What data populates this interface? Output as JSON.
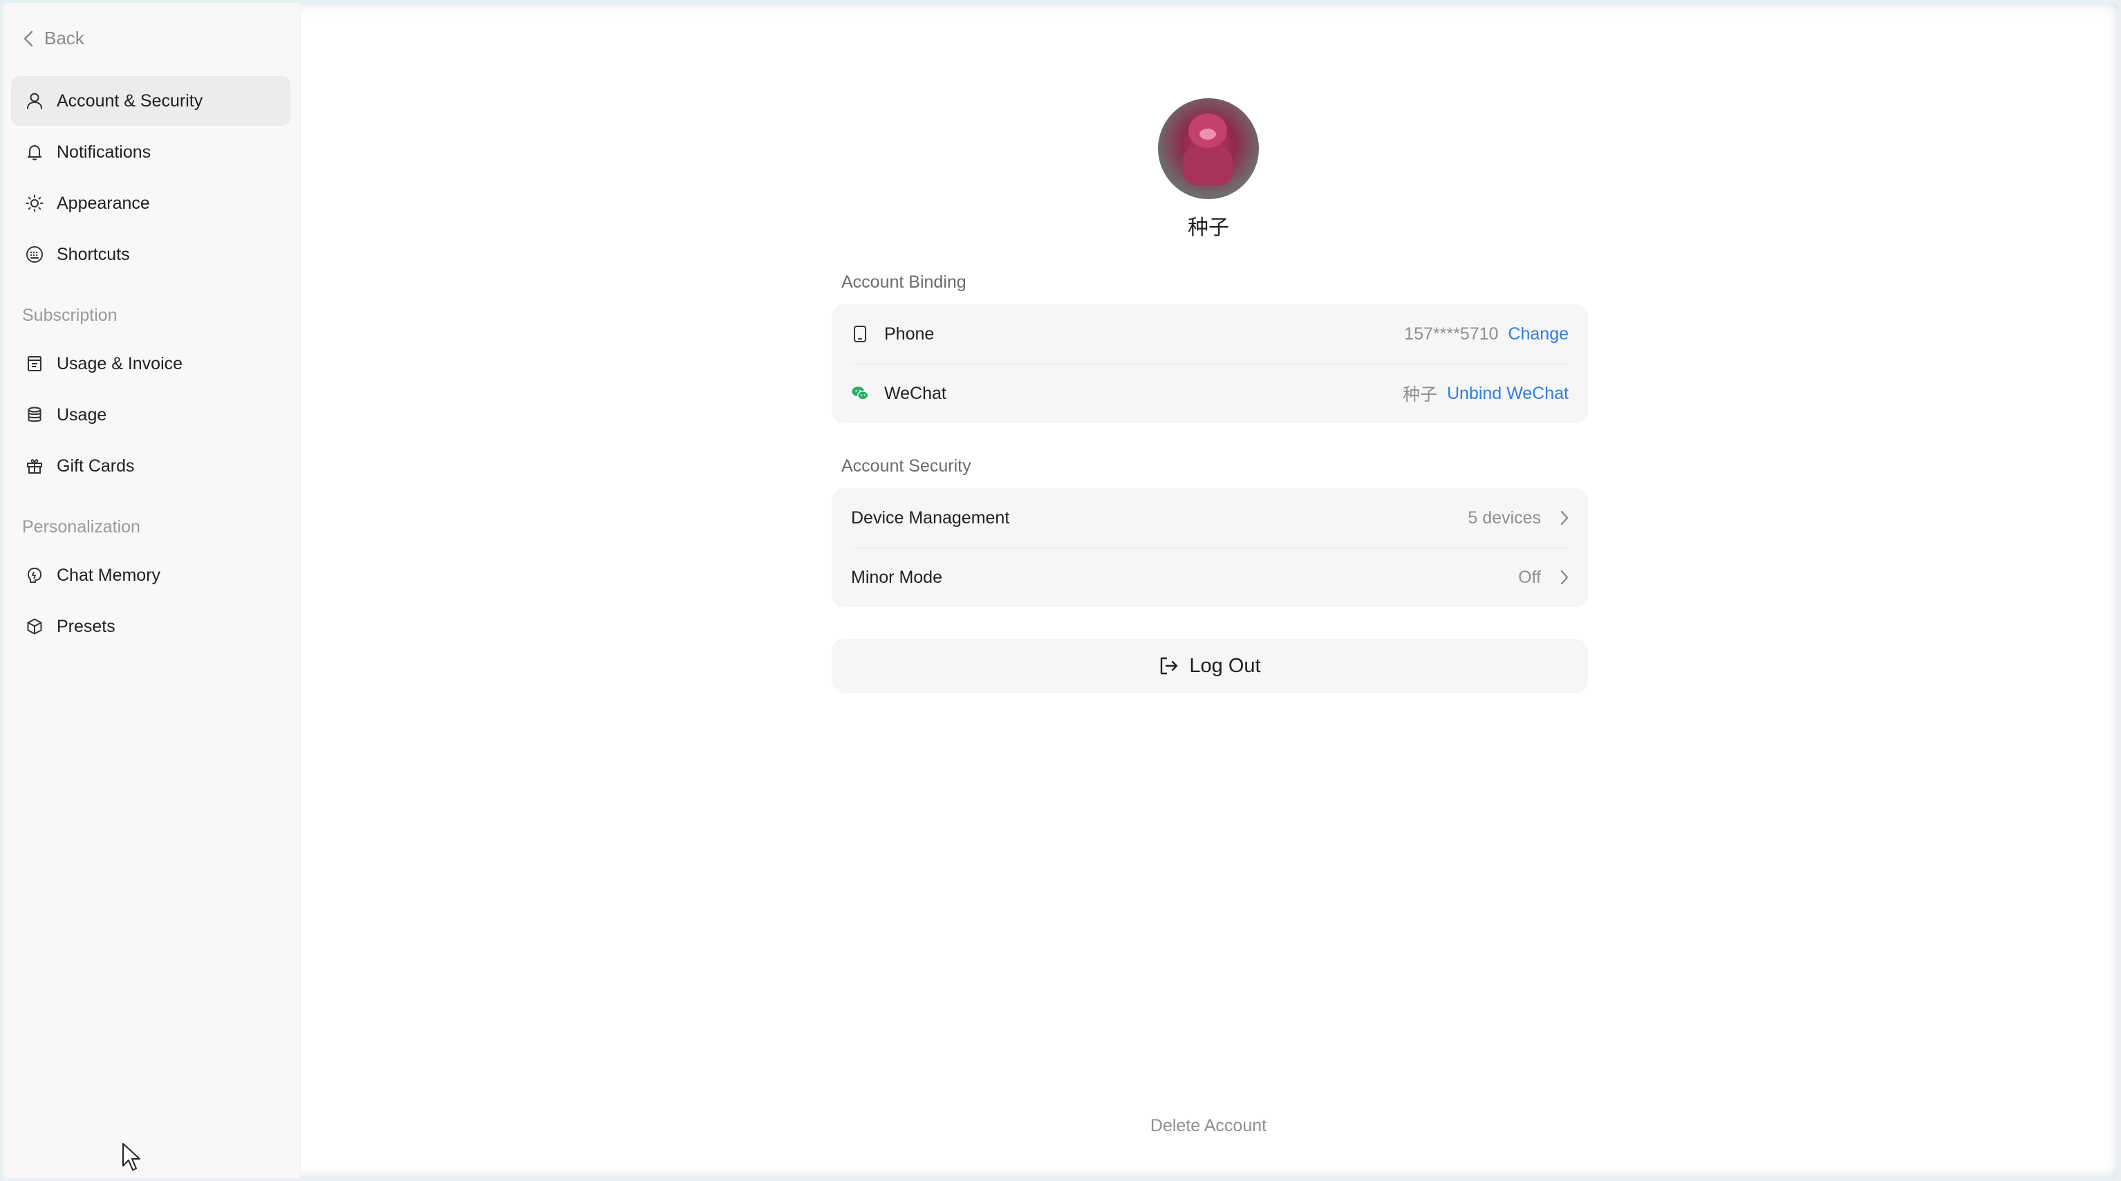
{
  "sidebar": {
    "back_label": "Back",
    "items_top": [
      {
        "label": "Account & Security",
        "icon": "user-icon",
        "active": true
      },
      {
        "label": "Notifications",
        "icon": "bell-icon"
      },
      {
        "label": "Appearance",
        "icon": "sun-icon"
      },
      {
        "label": "Shortcuts",
        "icon": "keyboard-icon"
      }
    ],
    "section_subscription": "Subscription",
    "items_subscription": [
      {
        "label": "Usage & Invoice",
        "icon": "invoice-icon"
      },
      {
        "label": "Usage",
        "icon": "database-icon"
      },
      {
        "label": "Gift Cards",
        "icon": "gift-icon"
      }
    ],
    "section_personalization": "Personalization",
    "items_personalization": [
      {
        "label": "Chat Memory",
        "icon": "memory-icon"
      },
      {
        "label": "Presets",
        "icon": "cube-icon"
      }
    ]
  },
  "profile": {
    "username": "种子"
  },
  "account_binding": {
    "title": "Account Binding",
    "phone": {
      "label": "Phone",
      "value": "157****5710",
      "action": "Change"
    },
    "wechat": {
      "label": "WeChat",
      "value": "种子",
      "action": "Unbind WeChat"
    }
  },
  "account_security": {
    "title": "Account Security",
    "device": {
      "label": "Device Management",
      "value": "5 devices"
    },
    "minor": {
      "label": "Minor Mode",
      "value": "Off"
    }
  },
  "logout_label": "Log Out",
  "delete_label": "Delete Account",
  "colors": {
    "accent_link": "#2f7de1",
    "wechat_green": "#2aae67",
    "sidebar_bg": "#f8f8f8",
    "card_bg": "#f6f6f6"
  }
}
